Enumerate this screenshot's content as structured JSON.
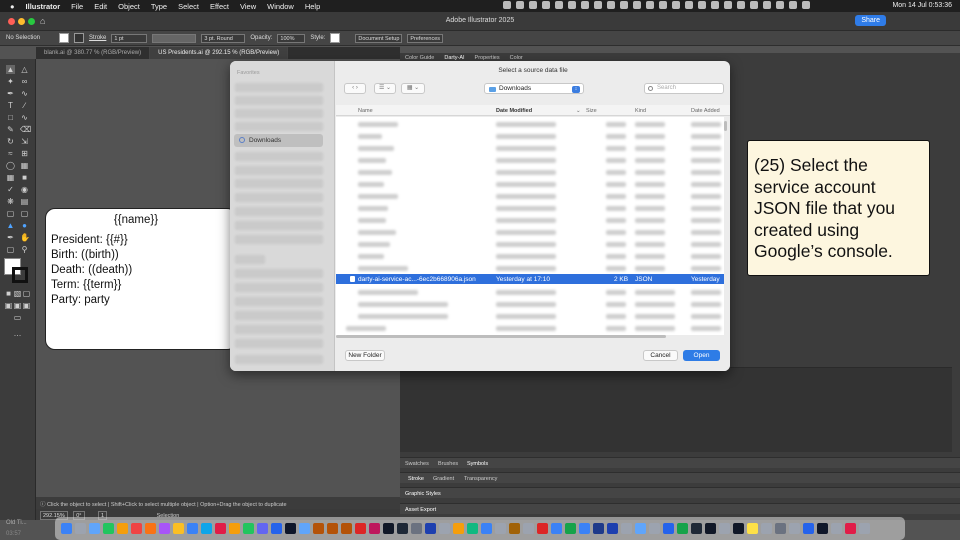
{
  "menubar": {
    "app": "Illustrator",
    "items": [
      "File",
      "Edit",
      "Object",
      "Type",
      "Select",
      "Effect",
      "View",
      "Window",
      "Help"
    ],
    "clock": "Mon 14 Jul 0:53:36"
  },
  "window": {
    "title": "Adobe Illustrator 2025",
    "share": "Share"
  },
  "control": {
    "selection": "No Selection",
    "stroke_label": "Stroke",
    "stroke_value": "1 pt",
    "brush": "3 pt. Round",
    "opacity_label": "Opacity:",
    "opacity_value": "100%",
    "style_label": "Style:",
    "doc_setup": "Document Setup",
    "preferences": "Preferences"
  },
  "tabs": [
    "blank.ai @ 380.77 % (RGB/Preview)",
    "US Presidents.ai @ 292.15 % (RGB/Preview)"
  ],
  "artboard": {
    "title": "{{name}}",
    "lines": [
      "President: {{#}}",
      "Birth: ((birth))",
      "Death: ((death))",
      "Term: {{term}}",
      "Party: party"
    ]
  },
  "statusbar": {
    "text": "Click the object to select  |  Shift+Click to select multiple object  |  Option+Drag the object to duplicate",
    "zoom": "292.15%",
    "rotation": "0°",
    "artboard_num": "1",
    "mode": "Selection"
  },
  "panel": {
    "tabs": [
      "Color Guide",
      "Darty-AI",
      "Properties",
      "Color"
    ],
    "tabs2": [
      "Swatches",
      "Brushes",
      "Symbols"
    ],
    "tabs3": [
      "Stroke",
      "Gradient",
      "Transparency"
    ],
    "graphic_styles": "Graphic Styles",
    "asset_export": "Asset Export"
  },
  "dialog": {
    "title": "Select a source data file",
    "favorites": "Favorites",
    "sidebar_selected": "Downloads",
    "location": "Downloads",
    "search_placeholder": "Search",
    "columns": [
      "Name",
      "Date Modified",
      "Size",
      "Kind",
      "Date Added"
    ],
    "selected_file": {
      "name": "darty-ai-service-ac...-6ec2b668906a.json",
      "modified": "Yesterday at 17:10",
      "size": "2 KB",
      "kind": "JSON",
      "added": "Yesterday"
    },
    "new_folder": "New Folder",
    "cancel": "Cancel",
    "open": "Open"
  },
  "callout": {
    "text": "(25) Select the service account JSON file that you created using Google’s console."
  },
  "dock_bottom": {
    "label": "Old Ti...",
    "time": "03:57"
  }
}
